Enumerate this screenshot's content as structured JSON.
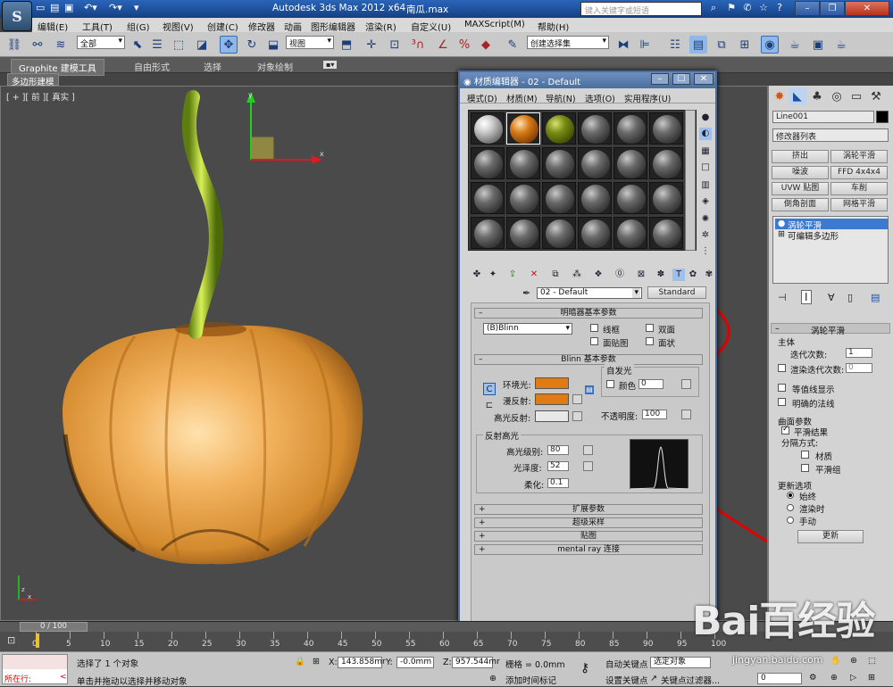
{
  "titlebar": {
    "title": "Autodesk 3ds Max  2012 x64",
    "file": "南瓜.max",
    "search_placeholder": "键入关键字或短语",
    "logo": "3ds-max-logo"
  },
  "menubar": [
    "编辑(E)",
    "工具(T)",
    "组(G)",
    "视图(V)",
    "创建(C)",
    "修改器",
    "动画",
    "图形编辑器",
    "渲染(R)",
    "自定义(U)",
    "MAXScript(M)",
    "帮助(H)"
  ],
  "toolbar": {
    "select_filter": "全部",
    "ref_coord": "视图",
    "named_selection": "创建选择集"
  },
  "ribbon": {
    "tabs": [
      "Graphite 建模工具",
      "自由形式",
      "选择",
      "对象绘制"
    ],
    "subtab": "多边形建模"
  },
  "viewport": {
    "label": "[ + ][ 前 ][ 真实 ]",
    "axis_x": "x",
    "axis_y": "y",
    "axis_z": "z"
  },
  "right_panel": {
    "object_name": "Line001",
    "modifier_list": "修改器列表",
    "buttons": [
      "挤出",
      "涡轮平滑",
      "噪波",
      "FFD 4x4x4",
      "UVW 贴图",
      "车削",
      "倒角剖面",
      "网格平滑"
    ],
    "stack": [
      "涡轮平滑",
      "可编辑多边形"
    ],
    "rollout_title": "涡轮平滑",
    "main_label": "主体",
    "iterations_label": "迭代次数:",
    "iterations": "1",
    "render_iters_label": "渲染迭代次数:",
    "render_iters": "0",
    "isoline": "等值线显示",
    "explicit_normals": "明确的法线",
    "surface_params": "曲面参数",
    "smooth_result": "平滑结果",
    "separate_by": "分隔方式:",
    "materials": "材质",
    "smoothing_groups": "平滑组",
    "update_options": "更新选项",
    "always": "始终",
    "when_rendering": "渲染时",
    "manually": "手动",
    "update_button": "更新"
  },
  "material_editor": {
    "title": "材质编辑器 - 02 - Default",
    "menu": [
      "模式(D)",
      "材质(M)",
      "导航(N)",
      "选项(O)",
      "实用程序(U)"
    ],
    "material_name": "02 - Default",
    "material_type": "Standard",
    "shader_rollout": "明暗器基本参数",
    "shader": "(B)Blinn",
    "wire": "线框",
    "two_sided": "双面",
    "face_map": "面贴图",
    "faceted": "面状",
    "blinn_rollout": "Blinn 基本参数",
    "self_illum": "自发光",
    "color": "颜色",
    "self_illum_val": "0",
    "ambient": "环境光:",
    "diffuse": "漫反射:",
    "specular": "高光反射:",
    "opacity_label": "不透明度:",
    "opacity": "100",
    "spec_highlights": "反射高光",
    "spec_level_label": "高光级别:",
    "spec_level": "80",
    "glossiness_label": "光泽度:",
    "glossiness": "52",
    "soften_label": "柔化:",
    "soften": "0.1",
    "rollouts": [
      "扩展参数",
      "超级采样",
      "贴图",
      "mental ray 连接"
    ],
    "colors": {
      "ambient": "#e07a12",
      "diffuse": "#e07a12",
      "specular": "#e8e8e8"
    }
  },
  "timeline": {
    "frame": "0 / 100",
    "ticks": [
      "0",
      "5",
      "10",
      "15",
      "20",
      "25",
      "30",
      "35",
      "40",
      "45",
      "50",
      "55",
      "60",
      "65",
      "70",
      "75",
      "80",
      "85",
      "90",
      "95",
      "100"
    ]
  },
  "status": {
    "script_label": "所在行:",
    "selected": "选择了 1 个对象",
    "hint": "单击并拖动以选择并移动对象",
    "x_label": "X:",
    "x": "143.858mr",
    "y_label": "Y:",
    "y": "-0.0mm",
    "z_label": "Z:",
    "z": "957.544mr",
    "grid": "栅格 = 0.0mm",
    "add_time_tag": "添加时间标记",
    "auto_key": "自动关键点",
    "set_key": "设置关键点",
    "selected_obj": "选定对象",
    "key_filters": "关键点过滤器...",
    "frame": "0"
  },
  "watermark": {
    "brand": "Bai百经验",
    "url": "jingyan.baidu.com"
  }
}
